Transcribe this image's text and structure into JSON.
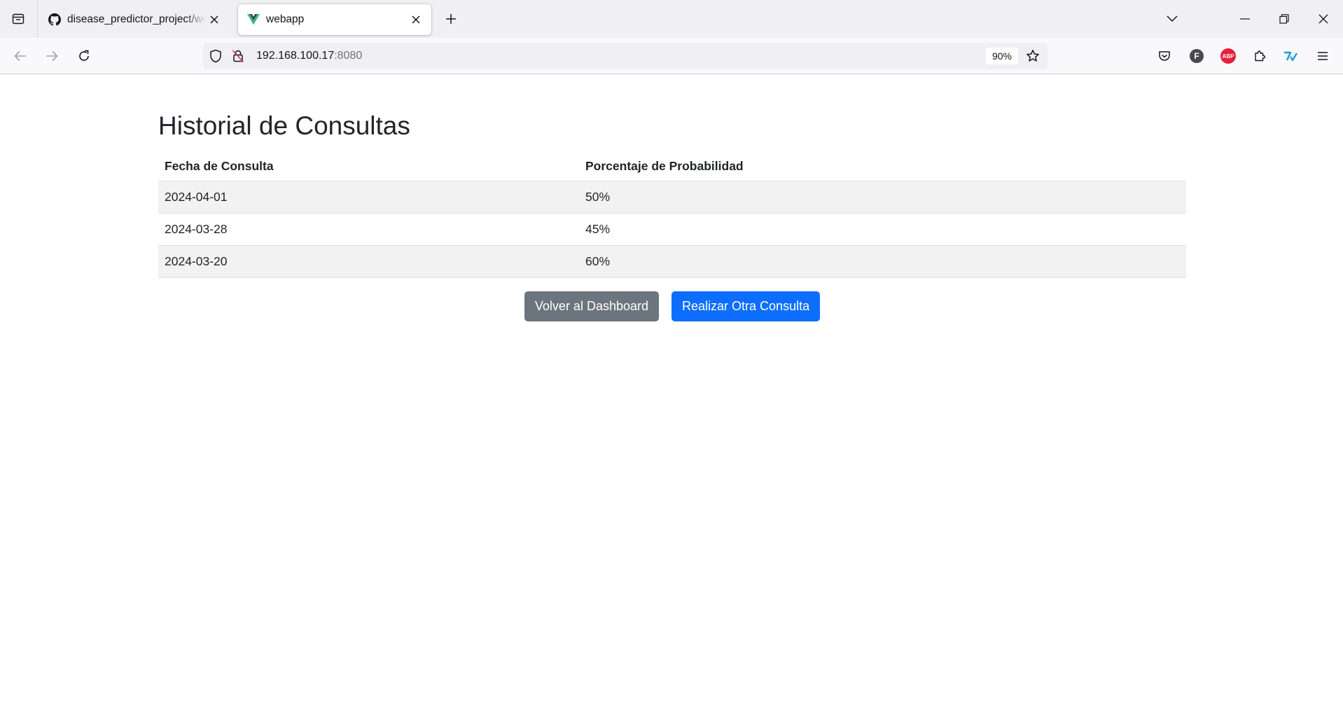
{
  "browser": {
    "tabs": [
      {
        "title": "disease_predictor_project/webapp",
        "favicon": "github-icon"
      },
      {
        "title": "webapp",
        "favicon": "vue-icon"
      }
    ],
    "url": {
      "host": "192.168.100.17",
      "port": ":8080"
    },
    "zoom": "90%",
    "extensions": {
      "profile_letter": "F",
      "adblock_label": "ABP"
    }
  },
  "page": {
    "title": "Historial de Consultas",
    "table": {
      "headers": [
        "Fecha de Consulta",
        "Porcentaje de Probabilidad"
      ],
      "rows": [
        [
          "2024-04-01",
          "50%"
        ],
        [
          "2024-03-28",
          "45%"
        ],
        [
          "2024-03-20",
          "60%"
        ]
      ]
    },
    "buttons": {
      "back": "Volver al Dashboard",
      "new_query": "Realizar Otra Consulta"
    }
  },
  "colors": {
    "secondary_button": "#6c757d",
    "primary_button": "#0d6efd",
    "stripe": "#f2f2f2",
    "vue_green": "#41b883",
    "adblock_red": "#e51f3b"
  }
}
